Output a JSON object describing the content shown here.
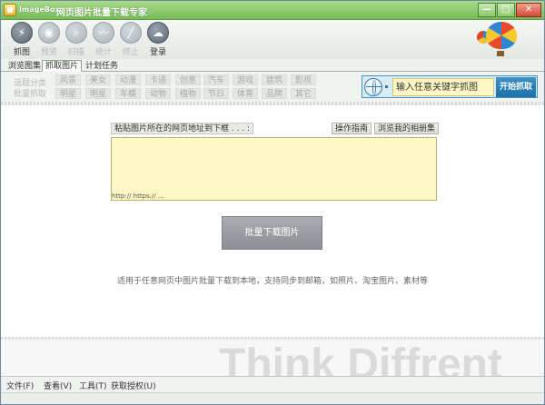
{
  "window": {
    "brand": "ImageBox",
    "title": "网页图片批量下载专家",
    "controls": {
      "minimize": "—",
      "maximize": "□",
      "close": "✕"
    }
  },
  "toolbar": {
    "items": [
      {
        "label": "抓图",
        "icon": "lightning-icon",
        "glyph": "⚡",
        "enabled": true
      },
      {
        "label": "预览",
        "icon": "eye-icon",
        "glyph": "◉",
        "enabled": false
      },
      {
        "label": "扫描",
        "icon": "magnifier-icon",
        "glyph": "⌕",
        "enabled": false
      },
      {
        "label": "统计",
        "icon": "wave-icon",
        "glyph": "〰",
        "enabled": false
      },
      {
        "label": "终止",
        "icon": "stop-icon",
        "glyph": "╱",
        "enabled": false
      },
      {
        "label": "登录",
        "icon": "cloud-upload-icon",
        "glyph": "☁",
        "enabled": true
      }
    ]
  },
  "tabs": [
    {
      "label": "浏览图集",
      "active": false
    },
    {
      "label": "抓取图片",
      "active": true
    },
    {
      "label": "计划任务",
      "active": false
    }
  ],
  "categories": {
    "side_label_1": "话题分类",
    "side_label_2": "批量抓取",
    "row1": [
      "风景",
      "美女",
      "动漫",
      "卡通",
      "创意",
      "汽车",
      "游戏",
      "建筑",
      "影视"
    ],
    "row2": [
      "明星",
      "明星",
      "车模",
      "动物",
      "植物",
      "节日",
      "体育",
      "品牌",
      "其它"
    ]
  },
  "search": {
    "placeholder": "输入任意关键字抓图",
    "button": "开始抓取"
  },
  "main": {
    "url_header": "粘贴图片所在的网页地址到下框 . . . :",
    "guide_button": "操作指南",
    "album_button": "浏览我的相册集",
    "url_hint": "http:// https:// ...",
    "download_button": "批量下载图片",
    "description": "适用于任意网页中图片批量下载到本地，支持同步到邮箱，如照片、淘宝图片、素材等"
  },
  "watermark": "Think Diffrent",
  "menu": [
    {
      "label": "文件(F)"
    },
    {
      "label": "查看(V)"
    },
    {
      "label": "工具(T)"
    },
    {
      "label": "获取授权(U)"
    }
  ],
  "colors": {
    "title_green": "#76bb58",
    "accent_blue": "#1e70a8",
    "input_yellow": "#fff8c4"
  }
}
